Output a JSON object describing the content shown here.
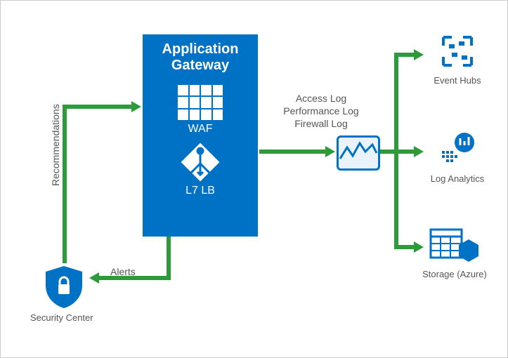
{
  "appgw": {
    "title1": "Application",
    "title2": "Gateway",
    "waf_label": "WAF",
    "l7_label": "L7 LB"
  },
  "security_center": {
    "label": "Security Center"
  },
  "labels": {
    "recommendations": "Recommendations",
    "alerts": "Alerts",
    "log1": "Access Log",
    "log2": "Performance Log",
    "log3": "Firewall Log"
  },
  "destinations": {
    "event_hubs": "Event Hubs",
    "log_analytics": "Log Analytics",
    "storage": "Storage (Azure)"
  },
  "colors": {
    "azure_blue": "#0072c6",
    "arrow_green": "#2e9b3a",
    "monitor_bg": "#eaf3fb"
  }
}
